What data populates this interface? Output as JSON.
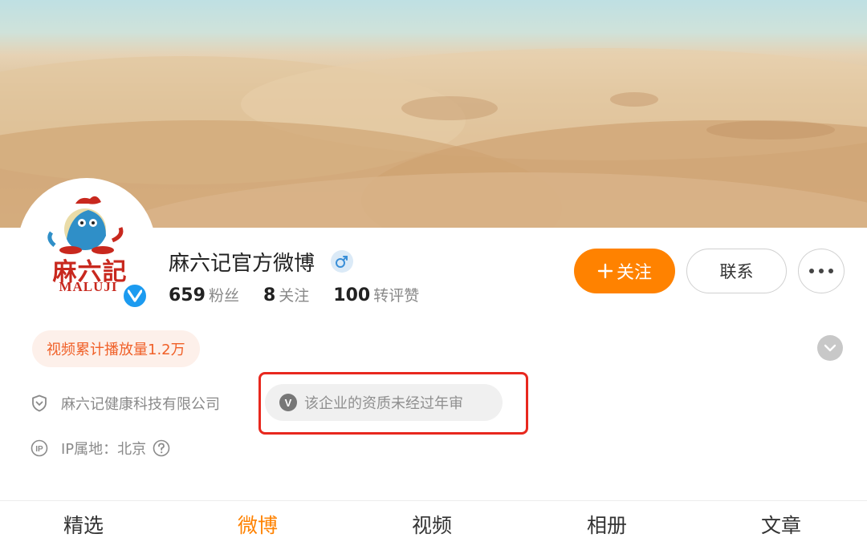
{
  "profile": {
    "name": "麻六记官方微博",
    "gender_icon": "male-icon",
    "verified_icon": "verified-v-icon",
    "avatar": {
      "logo_cn": "麻六記",
      "logo_en": "MALUJI"
    },
    "stats": [
      {
        "value": "659",
        "label": "粉丝"
      },
      {
        "value": "8",
        "label": "关注"
      },
      {
        "value": "100",
        "label": "转评赞"
      }
    ]
  },
  "actions": {
    "follow_label": "关注",
    "follow_icon": "plus-icon",
    "contact_label": "联系",
    "more_icon": "more-dots-icon"
  },
  "video_tag": "视频累计播放量1.2万",
  "company": {
    "icon": "shield-icon",
    "name": "麻六记健康科技有限公司"
  },
  "audit": {
    "badge": "V",
    "text": "该企业的资质未经过年审"
  },
  "ip": {
    "icon": "ip-icon",
    "text": "IP属地：北京",
    "help_icon": "question-icon"
  },
  "tabs": [
    {
      "label": "精选"
    },
    {
      "label": "微博",
      "active": true
    },
    {
      "label": "视频"
    },
    {
      "label": "相册"
    },
    {
      "label": "文章"
    }
  ],
  "colors": {
    "accent": "#ff8200",
    "verified": "#1c9bf0",
    "highlight_box": "#e8281e",
    "video_tag_text": "#f06028",
    "video_tag_bg": "#fdf0ea"
  }
}
